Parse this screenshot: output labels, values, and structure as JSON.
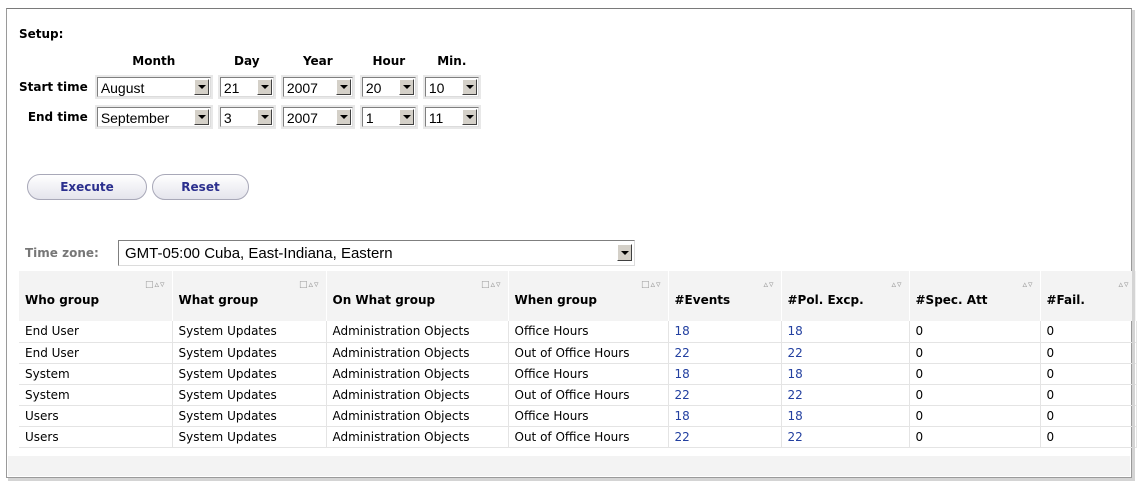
{
  "setup": {
    "label": "Setup:",
    "columns": [
      "Month",
      "Day",
      "Year",
      "Hour",
      "Min."
    ],
    "start": {
      "label": "Start time",
      "month": "August",
      "day": "21",
      "year": "2007",
      "hour": "20",
      "min": "10"
    },
    "end": {
      "label": "End time",
      "month": "September",
      "day": "3",
      "year": "2007",
      "hour": "1",
      "min": "11"
    }
  },
  "buttons": {
    "execute": "Execute",
    "reset": "Reset"
  },
  "timezone": {
    "label": "Time zone:",
    "value": "GMT-05:00 Cuba, East-Indiana, Eastern"
  },
  "table": {
    "headers": [
      "Who group",
      "What group",
      "On What group",
      "When group",
      "#Events",
      "#Pol. Excp.",
      "#Spec. Att",
      "#Fail."
    ],
    "rows": [
      [
        "End User",
        "System Updates",
        "Administration Objects",
        "Office Hours",
        "18",
        "18",
        "0",
        "0"
      ],
      [
        "End User",
        "System Updates",
        "Administration Objects",
        "Out of Office Hours",
        "22",
        "22",
        "0",
        "0"
      ],
      [
        "System",
        "System Updates",
        "Administration Objects",
        "Office Hours",
        "18",
        "18",
        "0",
        "0"
      ],
      [
        "System",
        "System Updates",
        "Administration Objects",
        "Out of Office Hours",
        "22",
        "22",
        "0",
        "0"
      ],
      [
        "Users",
        "System Updates",
        "Administration Objects",
        "Office Hours",
        "18",
        "18",
        "0",
        "0"
      ],
      [
        "Users",
        "System Updates",
        "Administration Objects",
        "Out of Office Hours",
        "22",
        "22",
        "0",
        "0"
      ]
    ]
  },
  "colors": {
    "link": "#2340a0",
    "button_text": "#2b2f8e",
    "header_bg": "#f3f3f3"
  }
}
